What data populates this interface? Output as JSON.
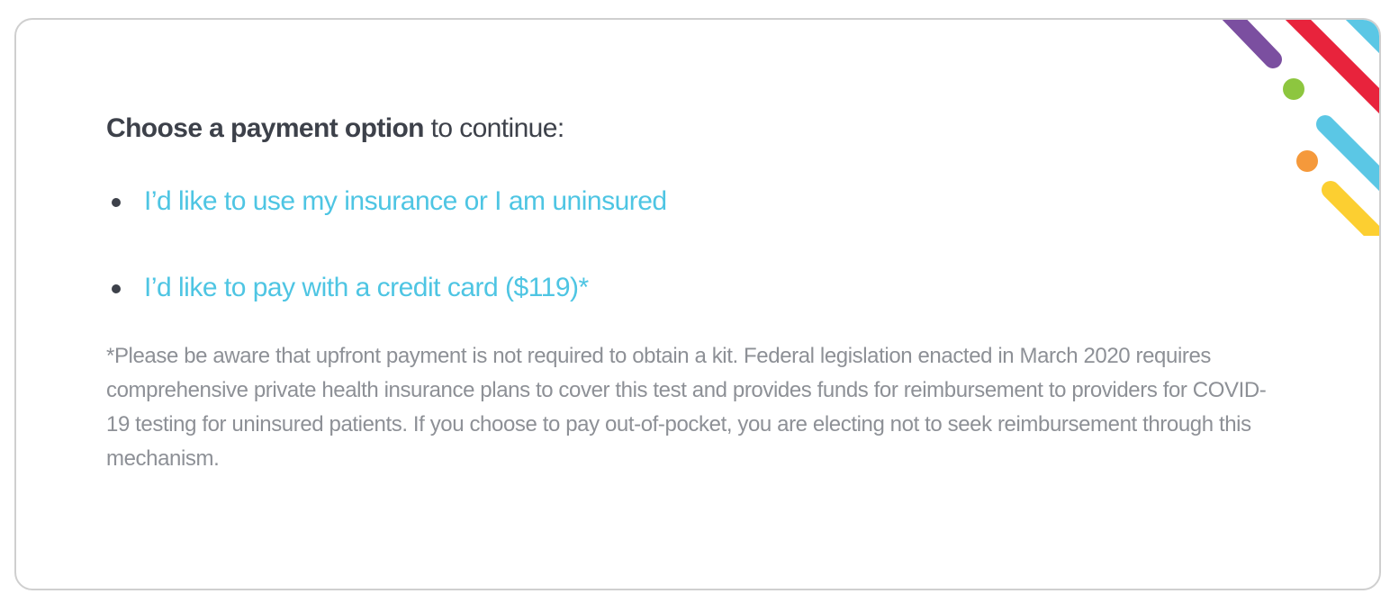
{
  "heading": {
    "bold": "Choose a payment option",
    "rest": " to continue:"
  },
  "options": [
    {
      "label": "I’d like to use my insurance or I am uninsured"
    },
    {
      "label": "I’d like to pay with a credit card ($119)*"
    }
  ],
  "disclaimer": "*Please be aware that upfront payment is not required to obtain a kit. Federal legislation enacted in March 2020 requires comprehensive private health insurance plans to cover this test and provides funds for reimbursement to providers for COVID-19 testing for uninsured patients. If you choose to pay out-of-pocket, you are electing not to seek reimbursement through this mechanism.",
  "colors": {
    "link": "#4ec5e3",
    "heading": "#3d414a",
    "disclaimer": "#8d9096",
    "stripe_purple": "#7b4fa0",
    "stripe_red": "#e8233c",
    "stripe_blue": "#5bc7e5",
    "dot_green": "#8dc63f",
    "dot_orange": "#f5993b",
    "stripe_yellow": "#fccf31"
  }
}
